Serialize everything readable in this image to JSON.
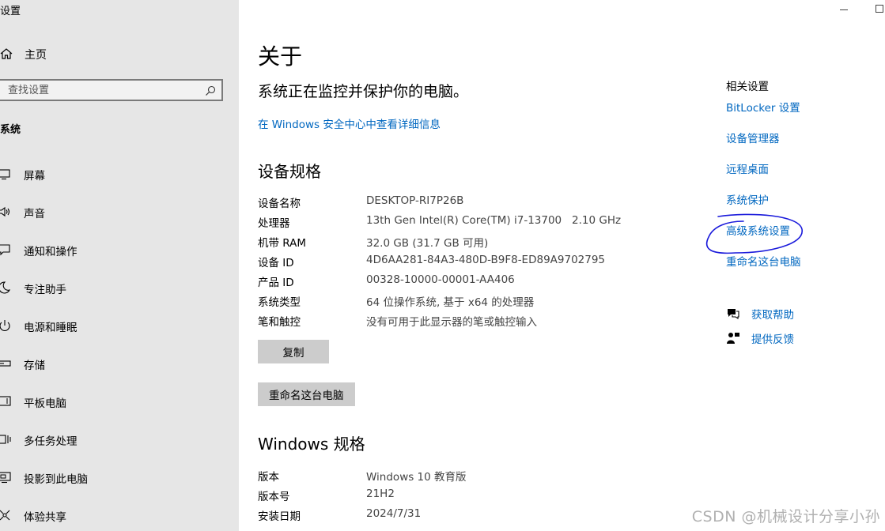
{
  "app": {
    "title": "设置"
  },
  "sidebar": {
    "home_label": "主页",
    "search_placeholder": "查找设置",
    "section_title": "系统",
    "items": [
      {
        "label": "屏幕",
        "icon": "display-icon"
      },
      {
        "label": "声音",
        "icon": "speaker-icon"
      },
      {
        "label": "通知和操作",
        "icon": "notification-icon"
      },
      {
        "label": "专注助手",
        "icon": "moon-icon"
      },
      {
        "label": "电源和睡眠",
        "icon": "power-icon"
      },
      {
        "label": "存储",
        "icon": "storage-icon"
      },
      {
        "label": "平板电脑",
        "icon": "tablet-icon"
      },
      {
        "label": "多任务处理",
        "icon": "multitask-icon"
      },
      {
        "label": "投影到此电脑",
        "icon": "project-icon"
      },
      {
        "label": "体验共享",
        "icon": "share-icon"
      }
    ]
  },
  "main": {
    "page_title": "关于",
    "protect_status": "系统正在监控并保护你的电脑。",
    "security_link": "在 Windows 安全中心中查看详细信息",
    "device_specs_title": "设备规格",
    "device_specs": [
      {
        "key": "设备名称",
        "value": "DESKTOP-RI7P26B"
      },
      {
        "key": "处理器",
        "value": "13th Gen Intel(R) Core(TM) i7-13700   2.10 GHz"
      },
      {
        "key": "机带 RAM",
        "value": "32.0 GB (31.7 GB 可用)"
      },
      {
        "key": "设备 ID",
        "value": "4D6AA281-84A3-480D-B9F8-ED89A9702795"
      },
      {
        "key": "产品 ID",
        "value": "00328-10000-00001-AA406"
      },
      {
        "key": "系统类型",
        "value": "64 位操作系统, 基于 x64 的处理器"
      },
      {
        "key": "笔和触控",
        "value": "没有可用于此显示器的笔或触控输入"
      }
    ],
    "copy_button": "复制",
    "rename_button": "重命名这台电脑",
    "windows_specs_title": "Windows 规格",
    "windows_specs": [
      {
        "key": "版本",
        "value": "Windows 10 教育版"
      },
      {
        "key": "版本号",
        "value": "21H2"
      },
      {
        "key": "安装日期",
        "value": "2024/7/31"
      }
    ]
  },
  "related": {
    "title": "相关设置",
    "links": [
      "BitLocker 设置",
      "设备管理器",
      "远程桌面",
      "系统保护",
      "高级系统设置",
      "重命名这台电脑"
    ],
    "help": [
      {
        "label": "获取帮助",
        "icon": "help-chat-icon"
      },
      {
        "label": "提供反馈",
        "icon": "feedback-icon"
      }
    ],
    "highlight_color": "#1a1adb"
  },
  "colors": {
    "sidebar_bg": "#e6e6e6",
    "link": "#0067c0",
    "button_bg": "#cccccc"
  },
  "watermark": "CSDN @机械设计分享小孙"
}
